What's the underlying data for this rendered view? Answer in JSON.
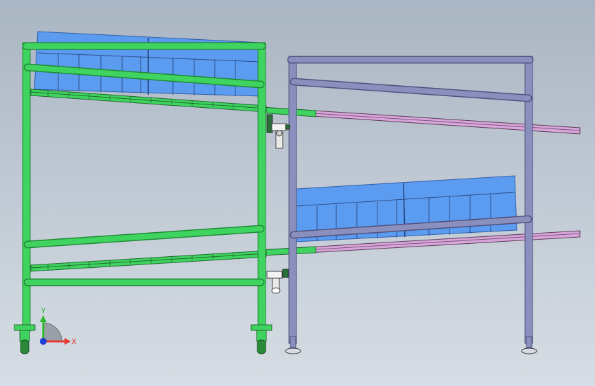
{
  "viewport": {
    "background_top": "#aab5c3",
    "background_bottom": "#d6dde4"
  },
  "colors": {
    "green_frame": "#3fd45f",
    "green_frame_dark": "#1f8a35",
    "purple_frame": "#8a8fbd",
    "purple_frame_dark": "#4e5280",
    "rail_pink": "#d9a6d9",
    "bin_blue": "#5b9bf0",
    "bin_blue_dark": "#2e5fa8"
  },
  "triad": {
    "x_label": "X",
    "y_label": "Y",
    "x_color": "#e53935",
    "y_color": "#2eb82e",
    "z_color": "#1e3fd6"
  }
}
